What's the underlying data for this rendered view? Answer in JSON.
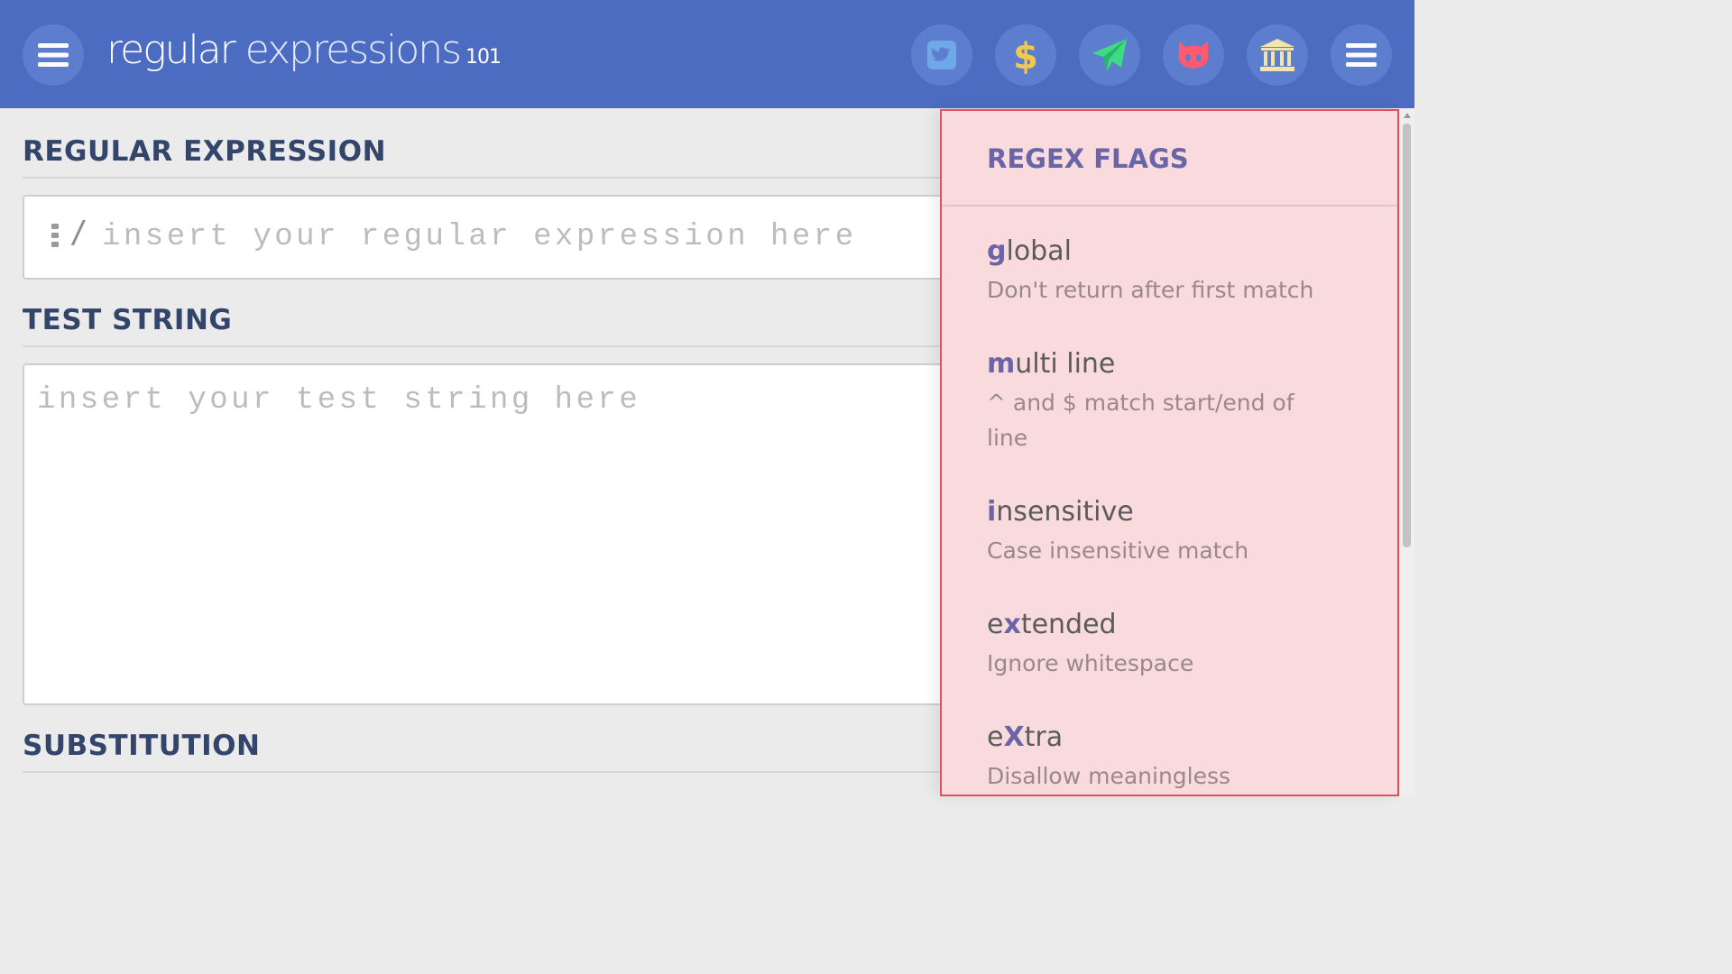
{
  "header": {
    "logo_regular": "regular",
    "logo_expressions": " expressions",
    "logo_version": "101",
    "icons": [
      "menu-icon",
      "twitter-icon",
      "dollar-icon",
      "paper-plane-icon",
      "github-icon",
      "bank-icon",
      "menu-icon"
    ]
  },
  "editor": {
    "regex_title": "REGULAR EXPRESSION",
    "regex_delimiter": "/",
    "regex_placeholder": "insert your regular expression here",
    "test_title": "TEST STRING",
    "test_placeholder": "insert your test string here",
    "substitution_title": "SUBSTITUTION"
  },
  "flags": {
    "title": "REGEX FLAGS",
    "items": [
      {
        "key": "g",
        "rest": "lobal",
        "prefix": "",
        "description": "Don't return after first match"
      },
      {
        "key": "m",
        "rest": "ulti line",
        "prefix": "",
        "description": "^ and $ match start/end of line"
      },
      {
        "key": "i",
        "rest": "nsensitive",
        "prefix": "",
        "description": "Case insensitive match"
      },
      {
        "key": "x",
        "rest": "tended",
        "prefix": "e",
        "description": "Ignore whitespace"
      },
      {
        "key": "X",
        "rest": "tra",
        "prefix": "e",
        "description": "Disallow meaningless"
      }
    ]
  },
  "colors": {
    "header_bg": "#4c6cc2",
    "panel_bg": "#f9dbdd",
    "panel_border": "#e0525f",
    "flag_key": "#6a64a8",
    "twitter": "#6fa8e8",
    "dollar": "#f2c94c",
    "plane": "#3ddc84",
    "github": "#ff5a6e",
    "bank": "#f3e5a6"
  }
}
